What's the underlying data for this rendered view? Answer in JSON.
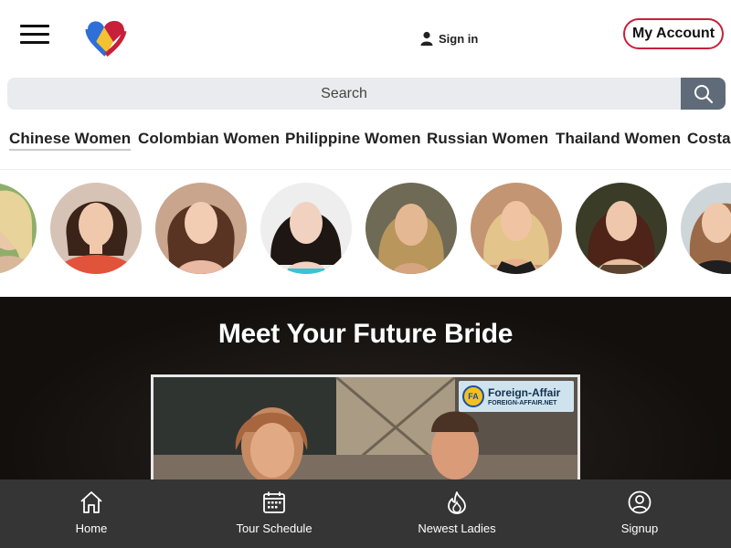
{
  "header": {
    "menu_icon": "hamburger-menu-icon",
    "logo_icon": "heart-logo-icon",
    "signin_label": "Sign in",
    "account_label": "My Account",
    "accent_color": "#c8203a"
  },
  "search": {
    "placeholder": "Search",
    "value": "",
    "button_icon": "search-icon"
  },
  "categories": [
    {
      "label": "Chinese Women",
      "active": true
    },
    {
      "label": "Colombian Women",
      "active": false
    },
    {
      "label": "Philippine Women",
      "active": false
    },
    {
      "label": "Russian Women",
      "active": false
    },
    {
      "label": "Thailand Women",
      "active": false
    },
    {
      "label": "Costa",
      "active": false
    }
  ],
  "profiles_count_visible": 8,
  "hero": {
    "title": "Meet Your Future Bride",
    "video_watermark_name": "Foreign-Affair",
    "video_watermark_url": "FOREIGN-AFFAIR.NET",
    "video_watermark_badge": "FA"
  },
  "bottom_nav": [
    {
      "label": "Home",
      "icon": "home-icon"
    },
    {
      "label": "Tour Schedule",
      "icon": "calendar-icon"
    },
    {
      "label": "Newest Ladies",
      "icon": "flame-icon"
    },
    {
      "label": "Signup",
      "icon": "user-circle-icon"
    }
  ]
}
